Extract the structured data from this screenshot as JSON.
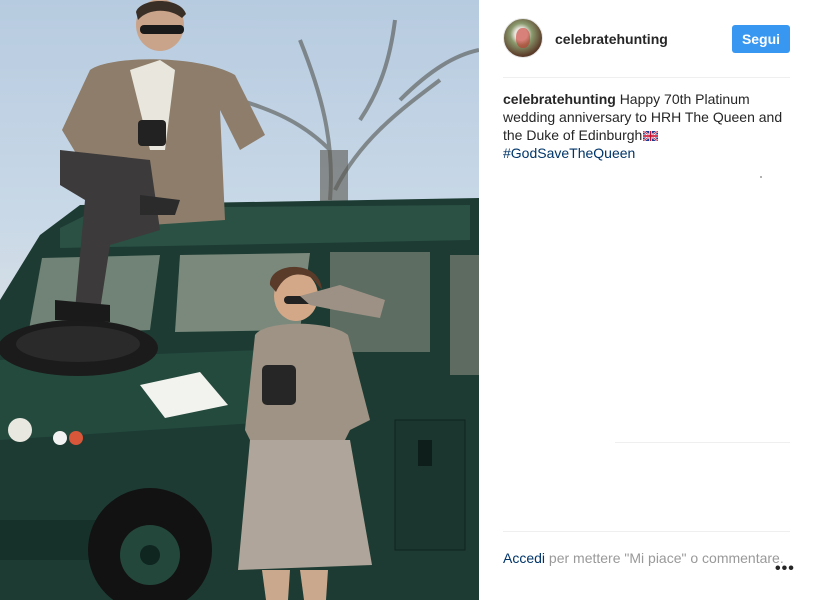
{
  "photo": {
    "alt": "Prince Philip seated on a green Land Rover and Queen Elizabeth shielding her eyes beside it"
  },
  "header": {
    "username": "celebratehunting",
    "follow_label": "Segui"
  },
  "caption": {
    "username": "celebratehunting",
    "text": "Happy 70th Platinum wedding anniversary to HRH The Queen and the Duke of Edinburgh",
    "flag_icon": "uk-flag-icon",
    "hashtag": "#GodSaveTheQueen"
  },
  "footer": {
    "login_label": "Accedi",
    "prompt_text": "per mettere \"Mi piace\" o commentare.",
    "more_label": "•••"
  },
  "colors": {
    "accent": "#3897f0",
    "link": "#003569",
    "muted": "#999999",
    "text": "#262626"
  }
}
